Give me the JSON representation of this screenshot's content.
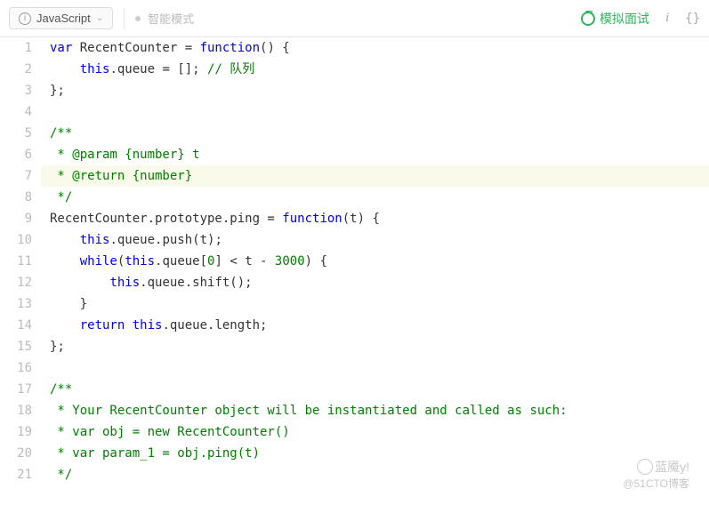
{
  "toolbar": {
    "language": "JavaScript",
    "mode_label": "智能模式",
    "mock_interview": "模拟面试",
    "info_char": "i",
    "braces": "{}"
  },
  "code": {
    "lines": [
      {
        "n": 1,
        "segs": [
          {
            "t": "var ",
            "c": "kw"
          },
          {
            "t": "RecentCounter = ",
            "c": "plain"
          },
          {
            "t": "function",
            "c": "kw"
          },
          {
            "t": "() {",
            "c": "plain"
          }
        ]
      },
      {
        "n": 2,
        "segs": [
          {
            "t": "    ",
            "c": "plain"
          },
          {
            "t": "this",
            "c": "kw"
          },
          {
            "t": ".queue = []; ",
            "c": "plain"
          },
          {
            "t": "// 队列",
            "c": "cmt"
          }
        ]
      },
      {
        "n": 3,
        "segs": [
          {
            "t": "};",
            "c": "plain"
          }
        ]
      },
      {
        "n": 4,
        "segs": [
          {
            "t": "",
            "c": "plain"
          }
        ]
      },
      {
        "n": 5,
        "segs": [
          {
            "t": "/**",
            "c": "doc"
          }
        ]
      },
      {
        "n": 6,
        "segs": [
          {
            "t": " * @param {number} t",
            "c": "doc"
          }
        ]
      },
      {
        "n": 7,
        "hl": true,
        "segs": [
          {
            "t": " * @return {number}",
            "c": "doc"
          }
        ]
      },
      {
        "n": 8,
        "segs": [
          {
            "t": " */",
            "c": "doc"
          }
        ]
      },
      {
        "n": 9,
        "segs": [
          {
            "t": "RecentCounter.prototype.ping = ",
            "c": "plain"
          },
          {
            "t": "function",
            "c": "kw"
          },
          {
            "t": "(t) {",
            "c": "plain"
          }
        ]
      },
      {
        "n": 10,
        "segs": [
          {
            "t": "    ",
            "c": "plain"
          },
          {
            "t": "this",
            "c": "kw"
          },
          {
            "t": ".queue.push(t);",
            "c": "plain"
          }
        ]
      },
      {
        "n": 11,
        "segs": [
          {
            "t": "    ",
            "c": "plain"
          },
          {
            "t": "while",
            "c": "kw"
          },
          {
            "t": "(",
            "c": "plain"
          },
          {
            "t": "this",
            "c": "kw"
          },
          {
            "t": ".queue[",
            "c": "plain"
          },
          {
            "t": "0",
            "c": "num"
          },
          {
            "t": "] < t - ",
            "c": "plain"
          },
          {
            "t": "3000",
            "c": "num"
          },
          {
            "t": ") {",
            "c": "plain"
          }
        ]
      },
      {
        "n": 12,
        "segs": [
          {
            "t": "        ",
            "c": "plain"
          },
          {
            "t": "this",
            "c": "kw"
          },
          {
            "t": ".queue.shift();",
            "c": "plain"
          }
        ]
      },
      {
        "n": 13,
        "segs": [
          {
            "t": "    }",
            "c": "plain"
          }
        ]
      },
      {
        "n": 14,
        "segs": [
          {
            "t": "    ",
            "c": "plain"
          },
          {
            "t": "return ",
            "c": "kw"
          },
          {
            "t": "this",
            "c": "kw"
          },
          {
            "t": ".queue.length;",
            "c": "plain"
          }
        ]
      },
      {
        "n": 15,
        "segs": [
          {
            "t": "};",
            "c": "plain"
          }
        ]
      },
      {
        "n": 16,
        "segs": [
          {
            "t": "",
            "c": "plain"
          }
        ]
      },
      {
        "n": 17,
        "segs": [
          {
            "t": "/**",
            "c": "doc"
          }
        ]
      },
      {
        "n": 18,
        "segs": [
          {
            "t": " * Your RecentCounter object will be instantiated and called as such:",
            "c": "doc"
          }
        ]
      },
      {
        "n": 19,
        "segs": [
          {
            "t": " * var obj = new RecentCounter()",
            "c": "doc"
          }
        ]
      },
      {
        "n": 20,
        "segs": [
          {
            "t": " * var param_1 = obj.ping(t)",
            "c": "doc"
          }
        ]
      },
      {
        "n": 21,
        "segs": [
          {
            "t": " */",
            "c": "doc"
          }
        ]
      }
    ]
  },
  "watermark": {
    "line1": "蓝魇y!",
    "line2": "@51CTO博客"
  }
}
